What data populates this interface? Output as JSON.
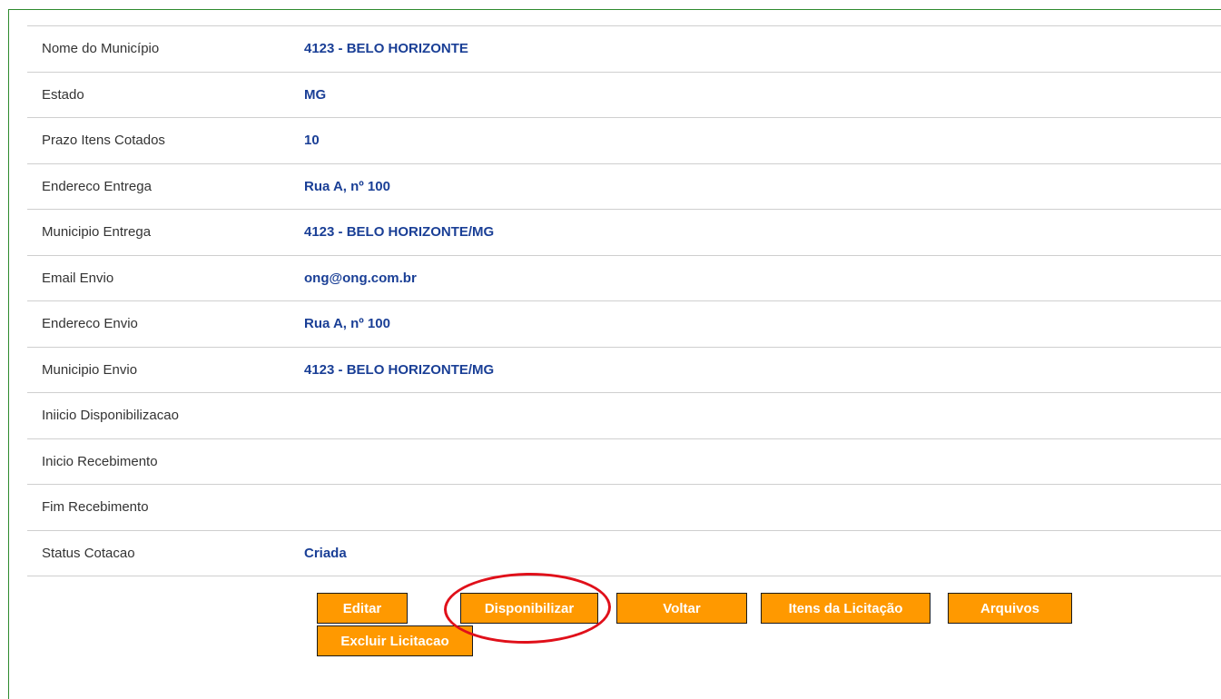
{
  "fields": [
    {
      "label": "Nome do Município",
      "value": "4123 - BELO HORIZONTE"
    },
    {
      "label": "Estado",
      "value": "MG"
    },
    {
      "label": "Prazo Itens Cotados",
      "value": "10"
    },
    {
      "label": "Endereco Entrega",
      "value": "Rua A, nº 100"
    },
    {
      "label": "Municipio Entrega",
      "value": "4123 - BELO HORIZONTE/MG"
    },
    {
      "label": "Email Envio",
      "value": "ong@ong.com.br"
    },
    {
      "label": "Endereco Envio",
      "value": "Rua A, nº 100"
    },
    {
      "label": "Municipio Envio",
      "value": "4123 - BELO HORIZONTE/MG"
    },
    {
      "label": "Iniicio Disponibilizacao",
      "value": ""
    },
    {
      "label": "Inicio Recebimento",
      "value": ""
    },
    {
      "label": "Fim Recebimento",
      "value": ""
    },
    {
      "label": "Status Cotacao",
      "value": "Criada"
    }
  ],
  "buttons": {
    "editar": "Editar",
    "disponibilizar": "Disponibilizar",
    "voltar": "Voltar",
    "itens": "Itens da Licitação",
    "arquivos": "Arquivos",
    "excluir": "Excluir Licitacao"
  },
  "colors": {
    "button_bg": "#ff9900",
    "value_text": "#1a3f96",
    "frame_border": "#2e8b2e",
    "highlight": "#e0101a"
  }
}
